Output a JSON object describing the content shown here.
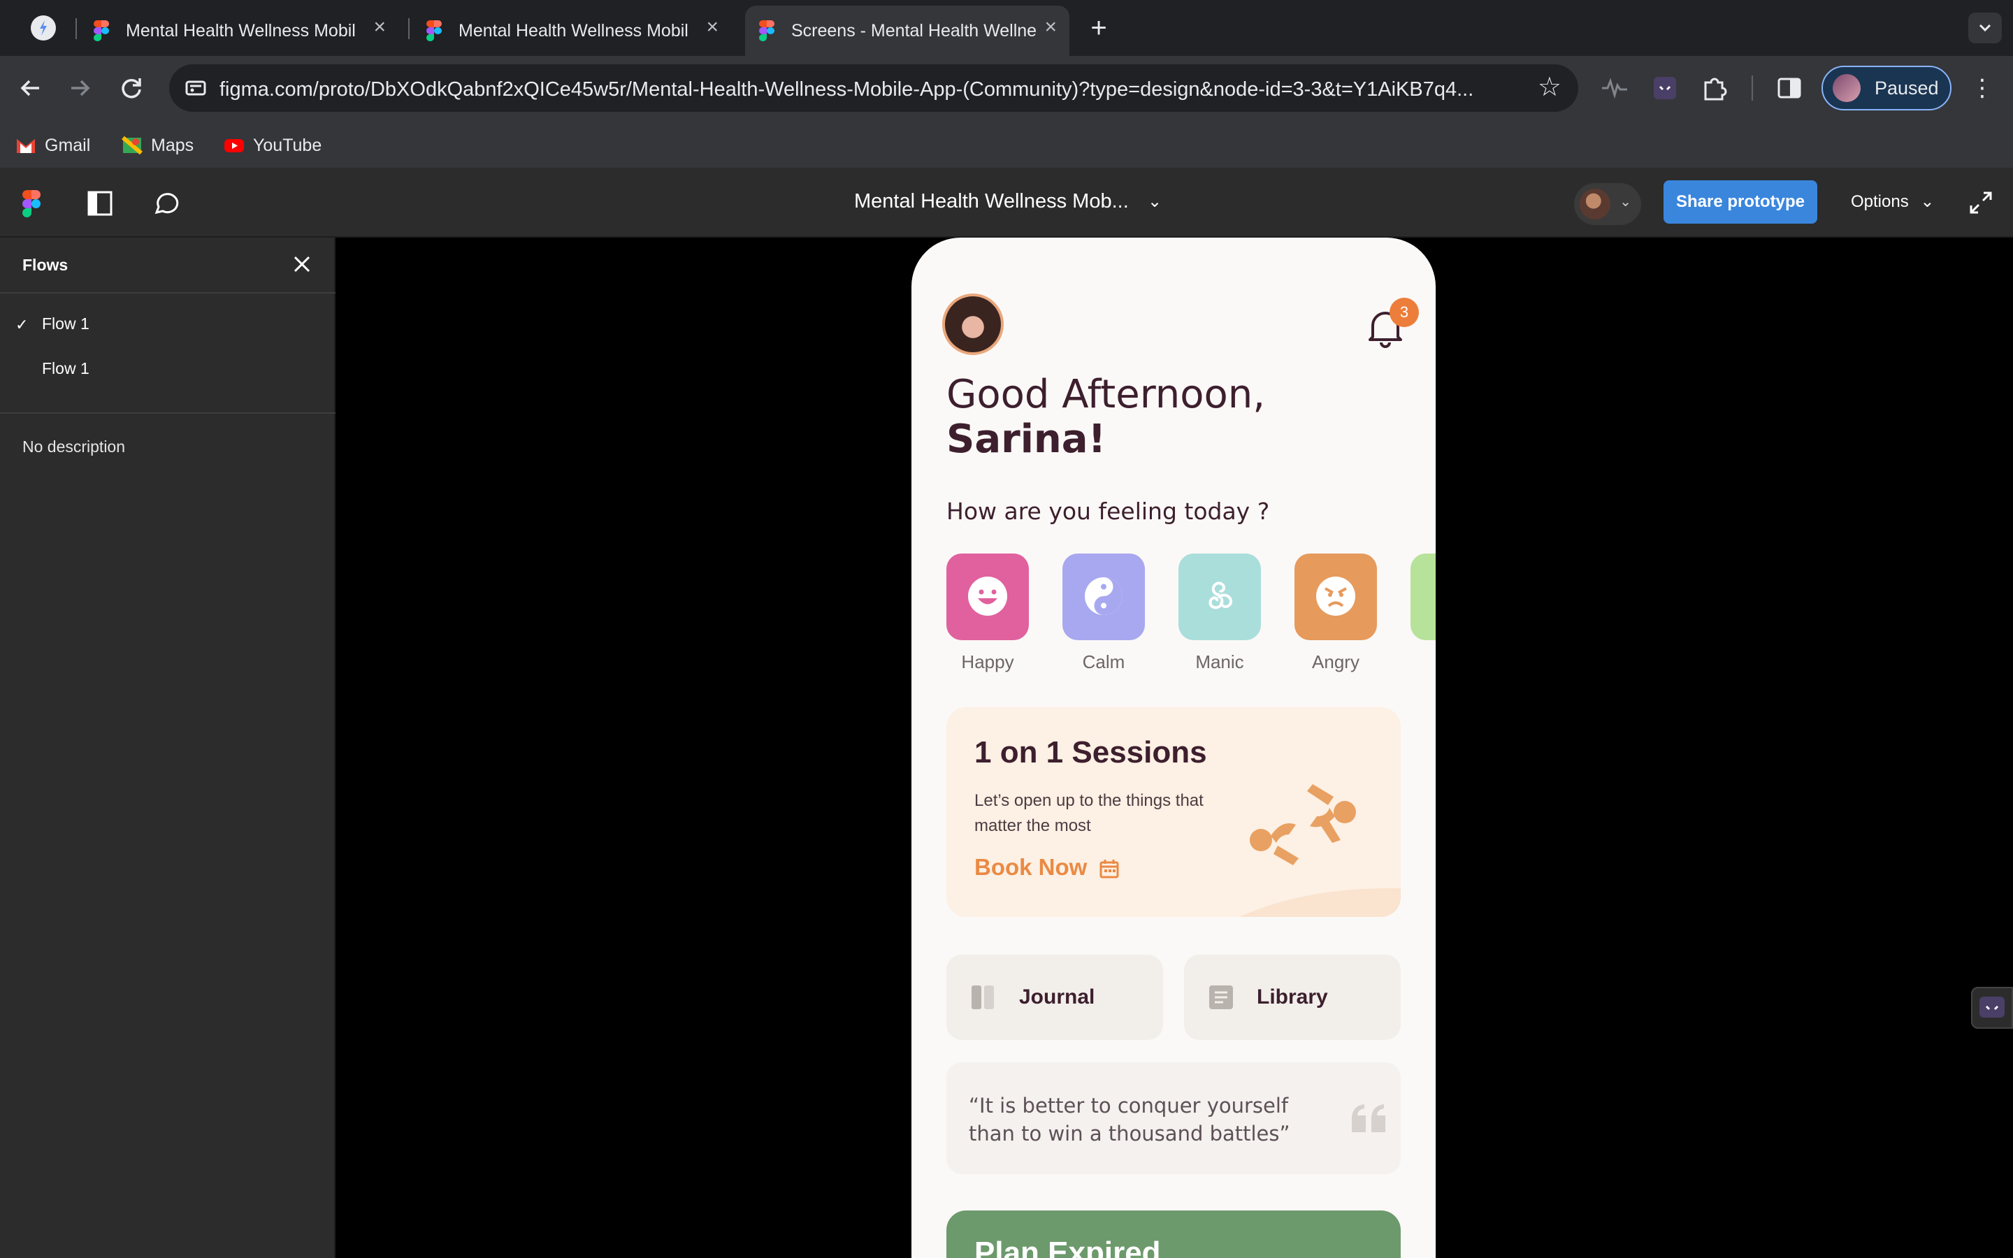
{
  "browser": {
    "tabs": [
      {
        "title": "Mental Health Wellness Mobile App (Community)",
        "active": false
      },
      {
        "title": "Mental Health Wellness Mobile App (Community)",
        "active": false
      },
      {
        "title": "Screens - Mental Health Wellness Mobile App",
        "active": true
      }
    ],
    "new_tab": "+",
    "url": "figma.com/proto/DbXOdkQabnf2xQICe45w5r/Mental-Health-Wellness-Mobile-App-(Community)?type=design&node-id=3-3&t=Y1AiKB7q4...",
    "profile_label": "Paused",
    "bookmarks": [
      {
        "label": "Gmail",
        "icon": "gmail-icon"
      },
      {
        "label": "Maps",
        "icon": "maps-icon"
      },
      {
        "label": "YouTube",
        "icon": "youtube-icon"
      }
    ]
  },
  "figma": {
    "file_title": "Mental Health Wellness Mob...",
    "share_label": "Share prototype",
    "options_label": "Options"
  },
  "sidebar": {
    "title": "Flows",
    "flows": [
      {
        "label": "Flow 1",
        "selected": true
      },
      {
        "label": "Flow 1",
        "selected": false
      }
    ],
    "description": "No description"
  },
  "app": {
    "notification_count": "3",
    "greeting_line1": "Good Afternoon,",
    "greeting_line2": "Sarina!",
    "question": "How are you feeling today ?",
    "moods": [
      {
        "label": "Happy",
        "color": "#e0619e"
      },
      {
        "label": "Calm",
        "color": "#a8a8f0"
      },
      {
        "label": "Manic",
        "color": "#a9dedb"
      },
      {
        "label": "Angry",
        "color": "#e69a5c"
      }
    ],
    "session": {
      "title": "1 on 1 Sessions",
      "description": "Let’s open up to the things that matter the most",
      "cta": "Book Now"
    },
    "quick_links": [
      {
        "label": "Journal",
        "icon": "journal-icon"
      },
      {
        "label": "Library",
        "icon": "library-icon"
      }
    ],
    "quote": "“It is better to conquer yourself than to win a thousand battles”",
    "plan_banner": "Plan Expired"
  },
  "colors": {
    "accent_orange": "#ed7d3a",
    "share_blue": "#3a86dd",
    "plan_green": "#6d9a6c",
    "text_dark": "#3d1f2e"
  }
}
